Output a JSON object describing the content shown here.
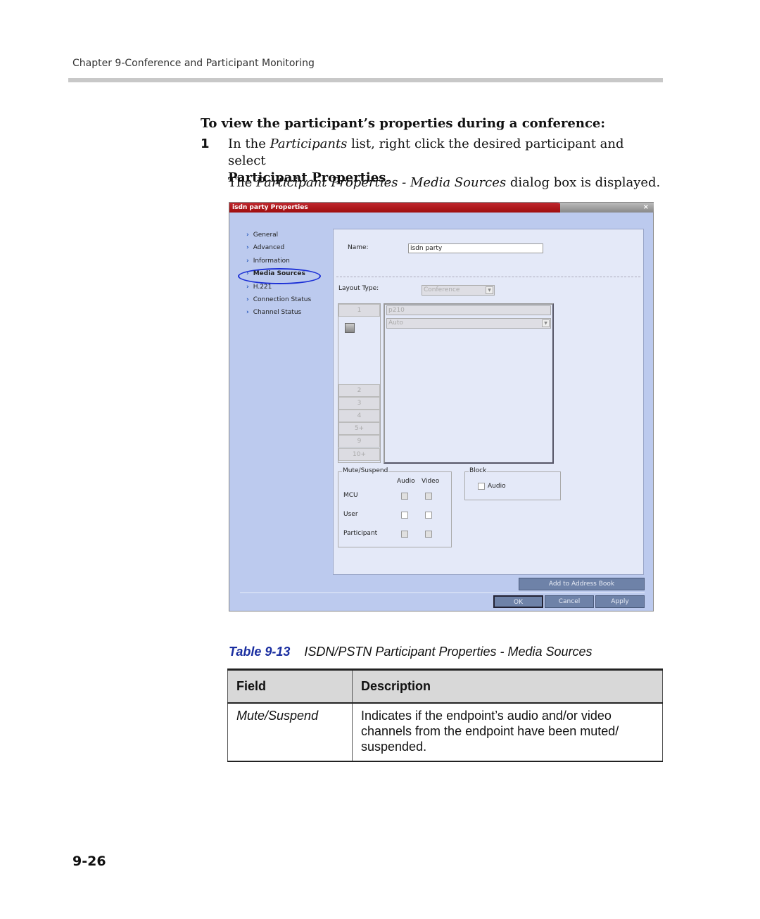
{
  "header": {
    "chapter": "Chapter 9-Conference and Participant Monitoring"
  },
  "procedure": {
    "heading": "To view the participant’s properties during a conference:",
    "step_number": "1",
    "step_pre": "In the ",
    "step_italic": "Participants",
    "step_mid": " list, right click the desired participant and select",
    "step_bold": "Participant Properties",
    "step_end": ".",
    "result_pre": "The ",
    "result_italic": "Participant Properties - Media Sources",
    "result_post": " dialog box is displayed."
  },
  "dialog": {
    "title": "isdn party Properties",
    "close": "×",
    "nav": [
      "General",
      "Advanced",
      "Information",
      "Media Sources",
      "H.221",
      "Connection Status",
      "Channel Status"
    ],
    "selected_nav": "Media Sources",
    "name_label": "Name:",
    "name_value": "isdn party",
    "layout_label": "Layout Type:",
    "layout_value": "Conference",
    "layout_cells": [
      "1",
      "2",
      "3",
      "4",
      "5+",
      "9",
      "10+"
    ],
    "source_value": "p210",
    "source_mode": "Auto",
    "mute": {
      "label": "Mute/Suspend",
      "audio": "Audio",
      "video": "Video",
      "rows": [
        "MCU",
        "User",
        "Participant"
      ]
    },
    "block": {
      "label": "Block",
      "audio": "Audio"
    },
    "buttons": {
      "address_book": "Add to Address Book",
      "ok": "OK",
      "cancel": "Cancel",
      "apply": "Apply"
    },
    "colors": {
      "title": "#b01a1e",
      "body": "#bccaee",
      "panel": "#e4e9f8",
      "button": "#6e82a8",
      "highlight": "#1b2fd6"
    }
  },
  "table": {
    "caption_num": "Table 9-13",
    "caption_text": "ISDN/PSTN Participant Properties - Media Sources",
    "headers": [
      "Field",
      "Description"
    ],
    "rows": [
      {
        "field": "Mute/Suspend",
        "description": "Indicates if the endpoint’s audio and/or video channels from the endpoint have been muted/ suspended."
      }
    ]
  },
  "page_number": "9-26"
}
